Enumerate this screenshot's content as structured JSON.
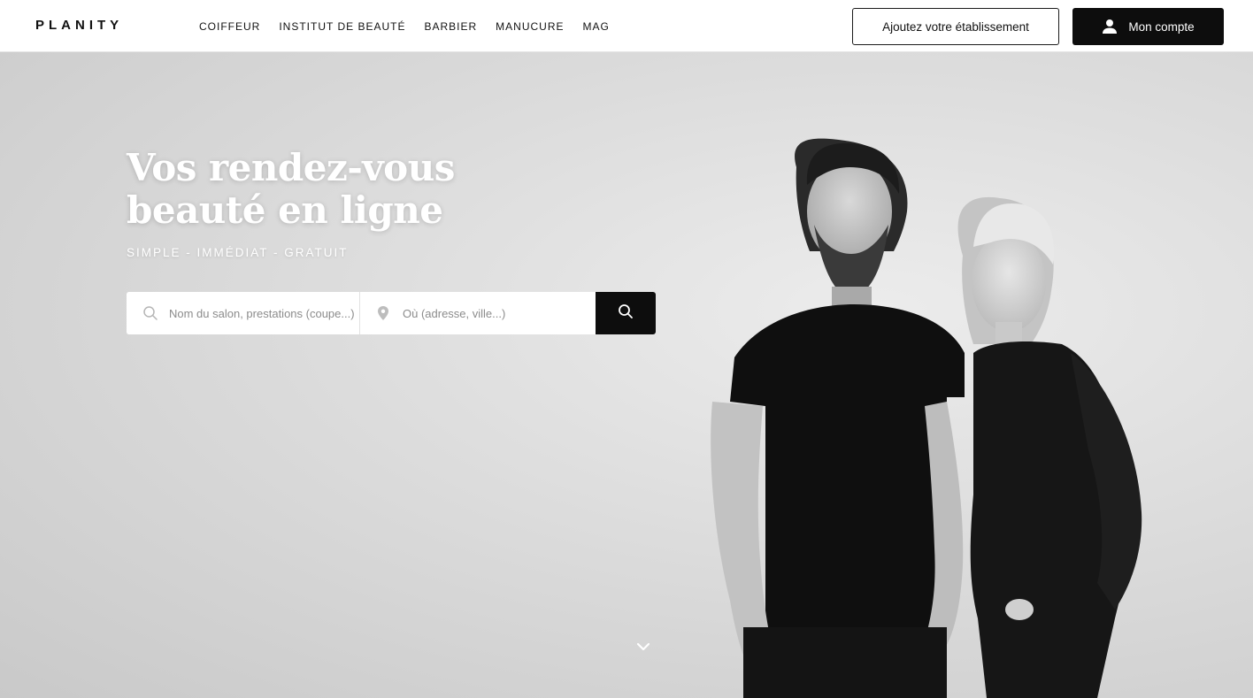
{
  "header": {
    "logo": "PLANITY",
    "nav": [
      {
        "label": "COIFFEUR"
      },
      {
        "label": "INSTITUT DE BEAUTÉ"
      },
      {
        "label": "BARBIER"
      },
      {
        "label": "MANUCURE"
      },
      {
        "label": "MAG"
      }
    ],
    "add_business_label": "Ajoutez votre établissement",
    "account_label": "Mon compte",
    "account_icon": "user-icon"
  },
  "hero": {
    "title_line1": "Vos rendez-vous",
    "title_line2": "beauté en ligne",
    "subtitle": "SIMPLE - IMMÉDIAT - GRATUIT",
    "image_description": "Black and white photo of a bearded man in a black t-shirt and a blonde woman in a black jacket"
  },
  "search": {
    "what_placeholder": "Nom du salon, prestations (coupe...)",
    "what_value": "",
    "what_icon": "search-icon",
    "where_placeholder": "Où (adresse, ville...)",
    "where_value": "",
    "where_icon": "location-pin-icon",
    "submit_icon": "search-icon"
  },
  "scroll_icon": "chevron-down-icon",
  "colors": {
    "primary_dark": "#0d0d0d",
    "header_bg": "#ffffff",
    "hero_text": "#ffffff"
  }
}
